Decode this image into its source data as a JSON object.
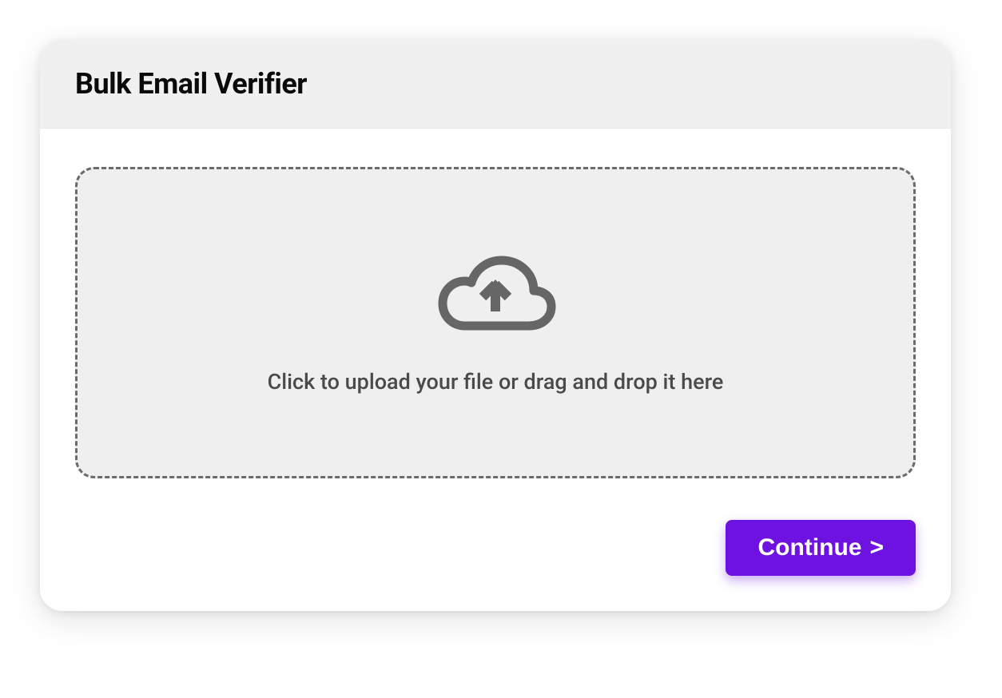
{
  "header": {
    "title": "Bulk Email Verifier"
  },
  "dropzone": {
    "instruction": "Click to upload your file or drag and drop it here",
    "icon": "cloud-upload-icon"
  },
  "actions": {
    "continue_label": "Continue",
    "continue_chevron": ">"
  },
  "colors": {
    "accent": "#6d12e0",
    "header_bg": "#f0f0f0",
    "dropzone_bg": "#efefef",
    "dropzone_border": "#6b6b6b",
    "text_dark": "#0a0a0a",
    "text_muted": "#4a4a4a"
  }
}
